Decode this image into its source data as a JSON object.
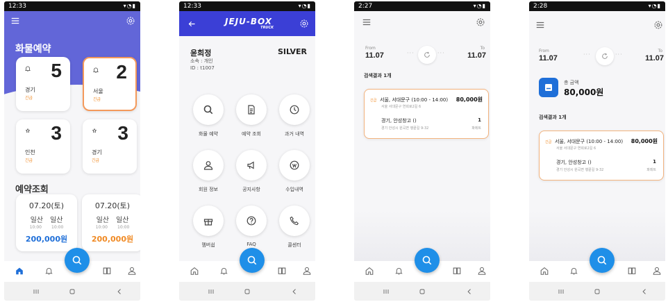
{
  "screen1": {
    "status_time": "12:33",
    "title": "화물예약",
    "tiles": [
      {
        "count": "5",
        "name": "경기",
        "tag": "긴급",
        "selected": false
      },
      {
        "count": "2",
        "name": "서울",
        "tag": "긴급",
        "selected": true
      },
      {
        "count": "3",
        "name": "인천",
        "tag": "긴급",
        "selected": false
      },
      {
        "count": "3",
        "name": "경기",
        "tag": "긴급",
        "selected": false
      }
    ],
    "section": "예약조회",
    "reservations": [
      {
        "date": "07.20(토)",
        "from": "일산",
        "to": "일산",
        "t1": "10:00",
        "t2": "10:00",
        "price": "200,000원",
        "price_color": "#1f6fd8"
      },
      {
        "date": "07.20(토)",
        "from": "일산",
        "to": "일산",
        "t1": "10:00",
        "t2": "10:00",
        "price": "200,000원",
        "price_color": "#f08a24"
      }
    ]
  },
  "screen2": {
    "status_time": "12:33",
    "logo": "JEJU-BOX",
    "logo_sub": "TRUCK",
    "user_name": "윤희정",
    "grade": "SILVER",
    "affiliation": "소속 : 개인",
    "user_id": "ID : t1007",
    "menu": [
      {
        "label": "화물 예약",
        "icon": "search-icon"
      },
      {
        "label": "예약 조회",
        "icon": "document-icon"
      },
      {
        "label": "과거 내역",
        "icon": "clock-icon"
      },
      {
        "label": "회원 정보",
        "icon": "person-icon"
      },
      {
        "label": "공지사항",
        "icon": "megaphone-icon"
      },
      {
        "label": "수입내역",
        "icon": "coin-icon"
      },
      {
        "label": "멤버쉽",
        "icon": "gift-icon"
      },
      {
        "label": "FAQ",
        "icon": "question-icon"
      },
      {
        "label": "콜센터",
        "icon": "phone-icon"
      }
    ]
  },
  "screen3": {
    "status_time": "2:27",
    "from_label": "From",
    "from_date": "11.07",
    "to_label": "To",
    "to_date": "11.07",
    "result_count": "검색결과 1개",
    "card": {
      "tag": "긴급",
      "line1": "서울, 서대문구 (10:00 - 14:00)",
      "price": "80,000원",
      "addr1": "서울 서대문구 연희로2길 6",
      "line2": "경기, 안성창고 ()",
      "qty": "1",
      "addr2": "경기 안성시 원곡면 행끝길 9-32",
      "unit": "파레트"
    }
  },
  "screen4": {
    "status_time": "2:28",
    "from_label": "From",
    "from_date": "11.07",
    "to_label": "To",
    "to_date": "11.07",
    "total_label": "총 금액",
    "total": "80,000원",
    "result_count": "검색결과 1개",
    "card": {
      "tag": "긴급",
      "line1": "서울, 서대문구 (10:00 - 14:00)",
      "price": "80,000원",
      "addr1": "서울 서대문구 연희로2길 6",
      "line2": "경기, 안성창고 ()",
      "qty": "1",
      "addr2": "경기 안성시 원곡면 행끝길 9-32",
      "unit": "파레트"
    }
  },
  "colors": {
    "primary": "#1f8fe8",
    "hero": "#6266d8",
    "accent": "#f08a24",
    "header": "#3b3fd6"
  }
}
